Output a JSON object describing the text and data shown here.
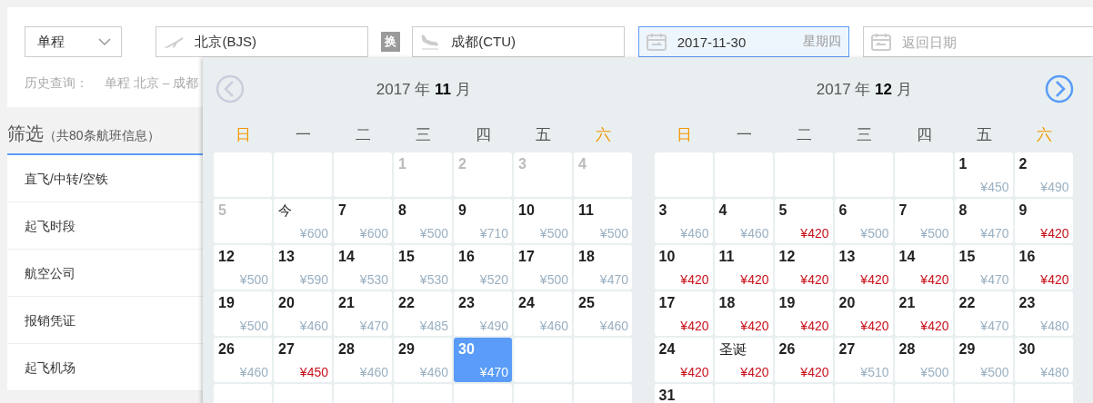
{
  "search": {
    "trip_type": {
      "value": "单程"
    },
    "from": {
      "value": "北京(BJS)"
    },
    "swap": {
      "label": "换"
    },
    "to": {
      "value": "成都(CTU)"
    },
    "depart_date": {
      "value": "2017-11-30",
      "weekday": "星期四"
    },
    "return_date": {
      "placeholder": "返回日期"
    },
    "history": {
      "label": "历史查询：",
      "entry": "单程 北京 – 成都"
    }
  },
  "filter": {
    "title": "筛选",
    "count": "（共80条航班信息）",
    "items": [
      "直飞/中转/空铁",
      "起飞时段",
      "航空公司",
      "报销凭证",
      "起飞机场"
    ]
  },
  "calendar": {
    "months": [
      {
        "title": "2017 年 **11** 月",
        "weekdays": [
          {
            "label": "日",
            "weekend": true
          },
          {
            "label": "一",
            "weekend": false
          },
          {
            "label": "二",
            "weekend": false
          },
          {
            "label": "三",
            "weekend": false
          },
          {
            "label": "四",
            "weekend": false
          },
          {
            "label": "五",
            "weekend": false
          },
          {
            "label": "六",
            "weekend": true
          }
        ],
        "weeks": [
          [
            {
              "kind": "empty"
            },
            {
              "kind": "empty"
            },
            {
              "kind": "empty"
            },
            {
              "kind": "day",
              "day": "1",
              "past": true,
              "selected": false
            },
            {
              "kind": "day",
              "day": "2",
              "past": true,
              "selected": false
            },
            {
              "kind": "day",
              "day": "3",
              "past": true,
              "selected": false
            },
            {
              "kind": "day",
              "day": "4",
              "past": true,
              "selected": false
            }
          ],
          [
            {
              "kind": "day",
              "day": "5",
              "past": true,
              "selected": false
            },
            {
              "kind": "festival",
              "day": "今",
              "price": "¥600",
              "low": false,
              "selected": false
            },
            {
              "kind": "day",
              "day": "7",
              "price": "¥600",
              "low": false,
              "selected": false
            },
            {
              "kind": "day",
              "day": "8",
              "price": "¥500",
              "low": false,
              "selected": false
            },
            {
              "kind": "day",
              "day": "9",
              "price": "¥710",
              "low": false,
              "selected": false
            },
            {
              "kind": "day",
              "day": "10",
              "price": "¥500",
              "low": false,
              "selected": false
            },
            {
              "kind": "day",
              "day": "11",
              "price": "¥500",
              "low": false,
              "selected": false
            }
          ],
          [
            {
              "kind": "day",
              "day": "12",
              "price": "¥500",
              "low": false,
              "selected": false
            },
            {
              "kind": "day",
              "day": "13",
              "price": "¥590",
              "low": false,
              "selected": false
            },
            {
              "kind": "day",
              "day": "14",
              "price": "¥530",
              "low": false,
              "selected": false
            },
            {
              "kind": "day",
              "day": "15",
              "price": "¥530",
              "low": false,
              "selected": false
            },
            {
              "kind": "day",
              "day": "16",
              "price": "¥520",
              "low": false,
              "selected": false
            },
            {
              "kind": "day",
              "day": "17",
              "price": "¥500",
              "low": false,
              "selected": false
            },
            {
              "kind": "day",
              "day": "18",
              "price": "¥470",
              "low": false,
              "selected": false
            }
          ],
          [
            {
              "kind": "day",
              "day": "19",
              "price": "¥500",
              "low": false,
              "selected": false
            },
            {
              "kind": "day",
              "day": "20",
              "price": "¥460",
              "low": false,
              "selected": false
            },
            {
              "kind": "day",
              "day": "21",
              "price": "¥470",
              "low": false,
              "selected": false
            },
            {
              "kind": "day",
              "day": "22",
              "price": "¥485",
              "low": false,
              "selected": false
            },
            {
              "kind": "day",
              "day": "23",
              "price": "¥490",
              "low": false,
              "selected": false
            },
            {
              "kind": "day",
              "day": "24",
              "price": "¥460",
              "low": false,
              "selected": false
            },
            {
              "kind": "day",
              "day": "25",
              "price": "¥460",
              "low": false,
              "selected": false
            }
          ],
          [
            {
              "kind": "day",
              "day": "26",
              "price": "¥460",
              "low": false,
              "selected": false
            },
            {
              "kind": "day",
              "day": "27",
              "price": "¥450",
              "low": true,
              "selected": false
            },
            {
              "kind": "day",
              "day": "28",
              "price": "¥460",
              "low": false,
              "selected": false
            },
            {
              "kind": "day",
              "day": "29",
              "price": "¥460",
              "low": false,
              "selected": false
            },
            {
              "kind": "day",
              "day": "30",
              "price": "¥470",
              "low": false,
              "selected": true
            },
            {
              "kind": "empty"
            },
            {
              "kind": "empty"
            }
          ],
          [
            {
              "kind": "empty"
            },
            {
              "kind": "empty"
            },
            {
              "kind": "empty"
            },
            {
              "kind": "empty"
            },
            {
              "kind": "empty"
            },
            {
              "kind": "empty"
            },
            {
              "kind": "empty"
            }
          ]
        ]
      },
      {
        "title": "2017 年 **12** 月",
        "weekdays": [
          {
            "label": "日",
            "weekend": true
          },
          {
            "label": "一",
            "weekend": false
          },
          {
            "label": "二",
            "weekend": false
          },
          {
            "label": "三",
            "weekend": false
          },
          {
            "label": "四",
            "weekend": false
          },
          {
            "label": "五",
            "weekend": false
          },
          {
            "label": "六",
            "weekend": true
          }
        ],
        "weeks": [
          [
            {
              "kind": "empty"
            },
            {
              "kind": "empty"
            },
            {
              "kind": "empty"
            },
            {
              "kind": "empty"
            },
            {
              "kind": "empty"
            },
            {
              "kind": "day",
              "day": "1",
              "price": "¥450",
              "low": false,
              "selected": false
            },
            {
              "kind": "day",
              "day": "2",
              "price": "¥490",
              "low": false,
              "selected": false
            }
          ],
          [
            {
              "kind": "day",
              "day": "3",
              "price": "¥460",
              "low": false,
              "selected": false
            },
            {
              "kind": "day",
              "day": "4",
              "price": "¥460",
              "low": false,
              "selected": false
            },
            {
              "kind": "day",
              "day": "5",
              "price": "¥420",
              "low": true,
              "selected": false
            },
            {
              "kind": "day",
              "day": "6",
              "price": "¥500",
              "low": false,
              "selected": false
            },
            {
              "kind": "day",
              "day": "7",
              "price": "¥500",
              "low": false,
              "selected": false
            },
            {
              "kind": "day",
              "day": "8",
              "price": "¥470",
              "low": false,
              "selected": false
            },
            {
              "kind": "day",
              "day": "9",
              "price": "¥420",
              "low": true,
              "selected": false
            }
          ],
          [
            {
              "kind": "day",
              "day": "10",
              "price": "¥420",
              "low": true,
              "selected": false
            },
            {
              "kind": "day",
              "day": "11",
              "price": "¥420",
              "low": true,
              "selected": false
            },
            {
              "kind": "day",
              "day": "12",
              "price": "¥420",
              "low": true,
              "selected": false
            },
            {
              "kind": "day",
              "day": "13",
              "price": "¥420",
              "low": true,
              "selected": false
            },
            {
              "kind": "day",
              "day": "14",
              "price": "¥420",
              "low": true,
              "selected": false
            },
            {
              "kind": "day",
              "day": "15",
              "price": "¥470",
              "low": false,
              "selected": false
            },
            {
              "kind": "day",
              "day": "16",
              "price": "¥420",
              "low": true,
              "selected": false
            }
          ],
          [
            {
              "kind": "day",
              "day": "17",
              "price": "¥420",
              "low": true,
              "selected": false
            },
            {
              "kind": "day",
              "day": "18",
              "price": "¥420",
              "low": true,
              "selected": false
            },
            {
              "kind": "day",
              "day": "19",
              "price": "¥420",
              "low": true,
              "selected": false
            },
            {
              "kind": "day",
              "day": "20",
              "price": "¥420",
              "low": true,
              "selected": false
            },
            {
              "kind": "day",
              "day": "21",
              "price": "¥420",
              "low": true,
              "selected": false
            },
            {
              "kind": "day",
              "day": "22",
              "price": "¥470",
              "low": false,
              "selected": false
            },
            {
              "kind": "day",
              "day": "23",
              "price": "¥480",
              "low": false,
              "selected": false
            }
          ],
          [
            {
              "kind": "day",
              "day": "24",
              "price": "¥420",
              "low": true,
              "selected": false
            },
            {
              "kind": "festival",
              "day": "圣诞",
              "price": "¥420",
              "low": true,
              "selected": false
            },
            {
              "kind": "day",
              "day": "26",
              "price": "¥420",
              "low": true,
              "selected": false
            },
            {
              "kind": "day",
              "day": "27",
              "price": "¥510",
              "low": false,
              "selected": false
            },
            {
              "kind": "day",
              "day": "28",
              "price": "¥500",
              "low": false,
              "selected": false
            },
            {
              "kind": "day",
              "day": "29",
              "price": "¥500",
              "low": false,
              "selected": false
            },
            {
              "kind": "day",
              "day": "30",
              "price": "¥480",
              "low": false,
              "selected": false
            }
          ],
          [
            {
              "kind": "day",
              "day": "31",
              "selected": false
            },
            {
              "kind": "empty"
            },
            {
              "kind": "empty"
            },
            {
              "kind": "empty"
            },
            {
              "kind": "empty"
            },
            {
              "kind": "empty"
            },
            {
              "kind": "empty"
            }
          ]
        ]
      }
    ]
  }
}
